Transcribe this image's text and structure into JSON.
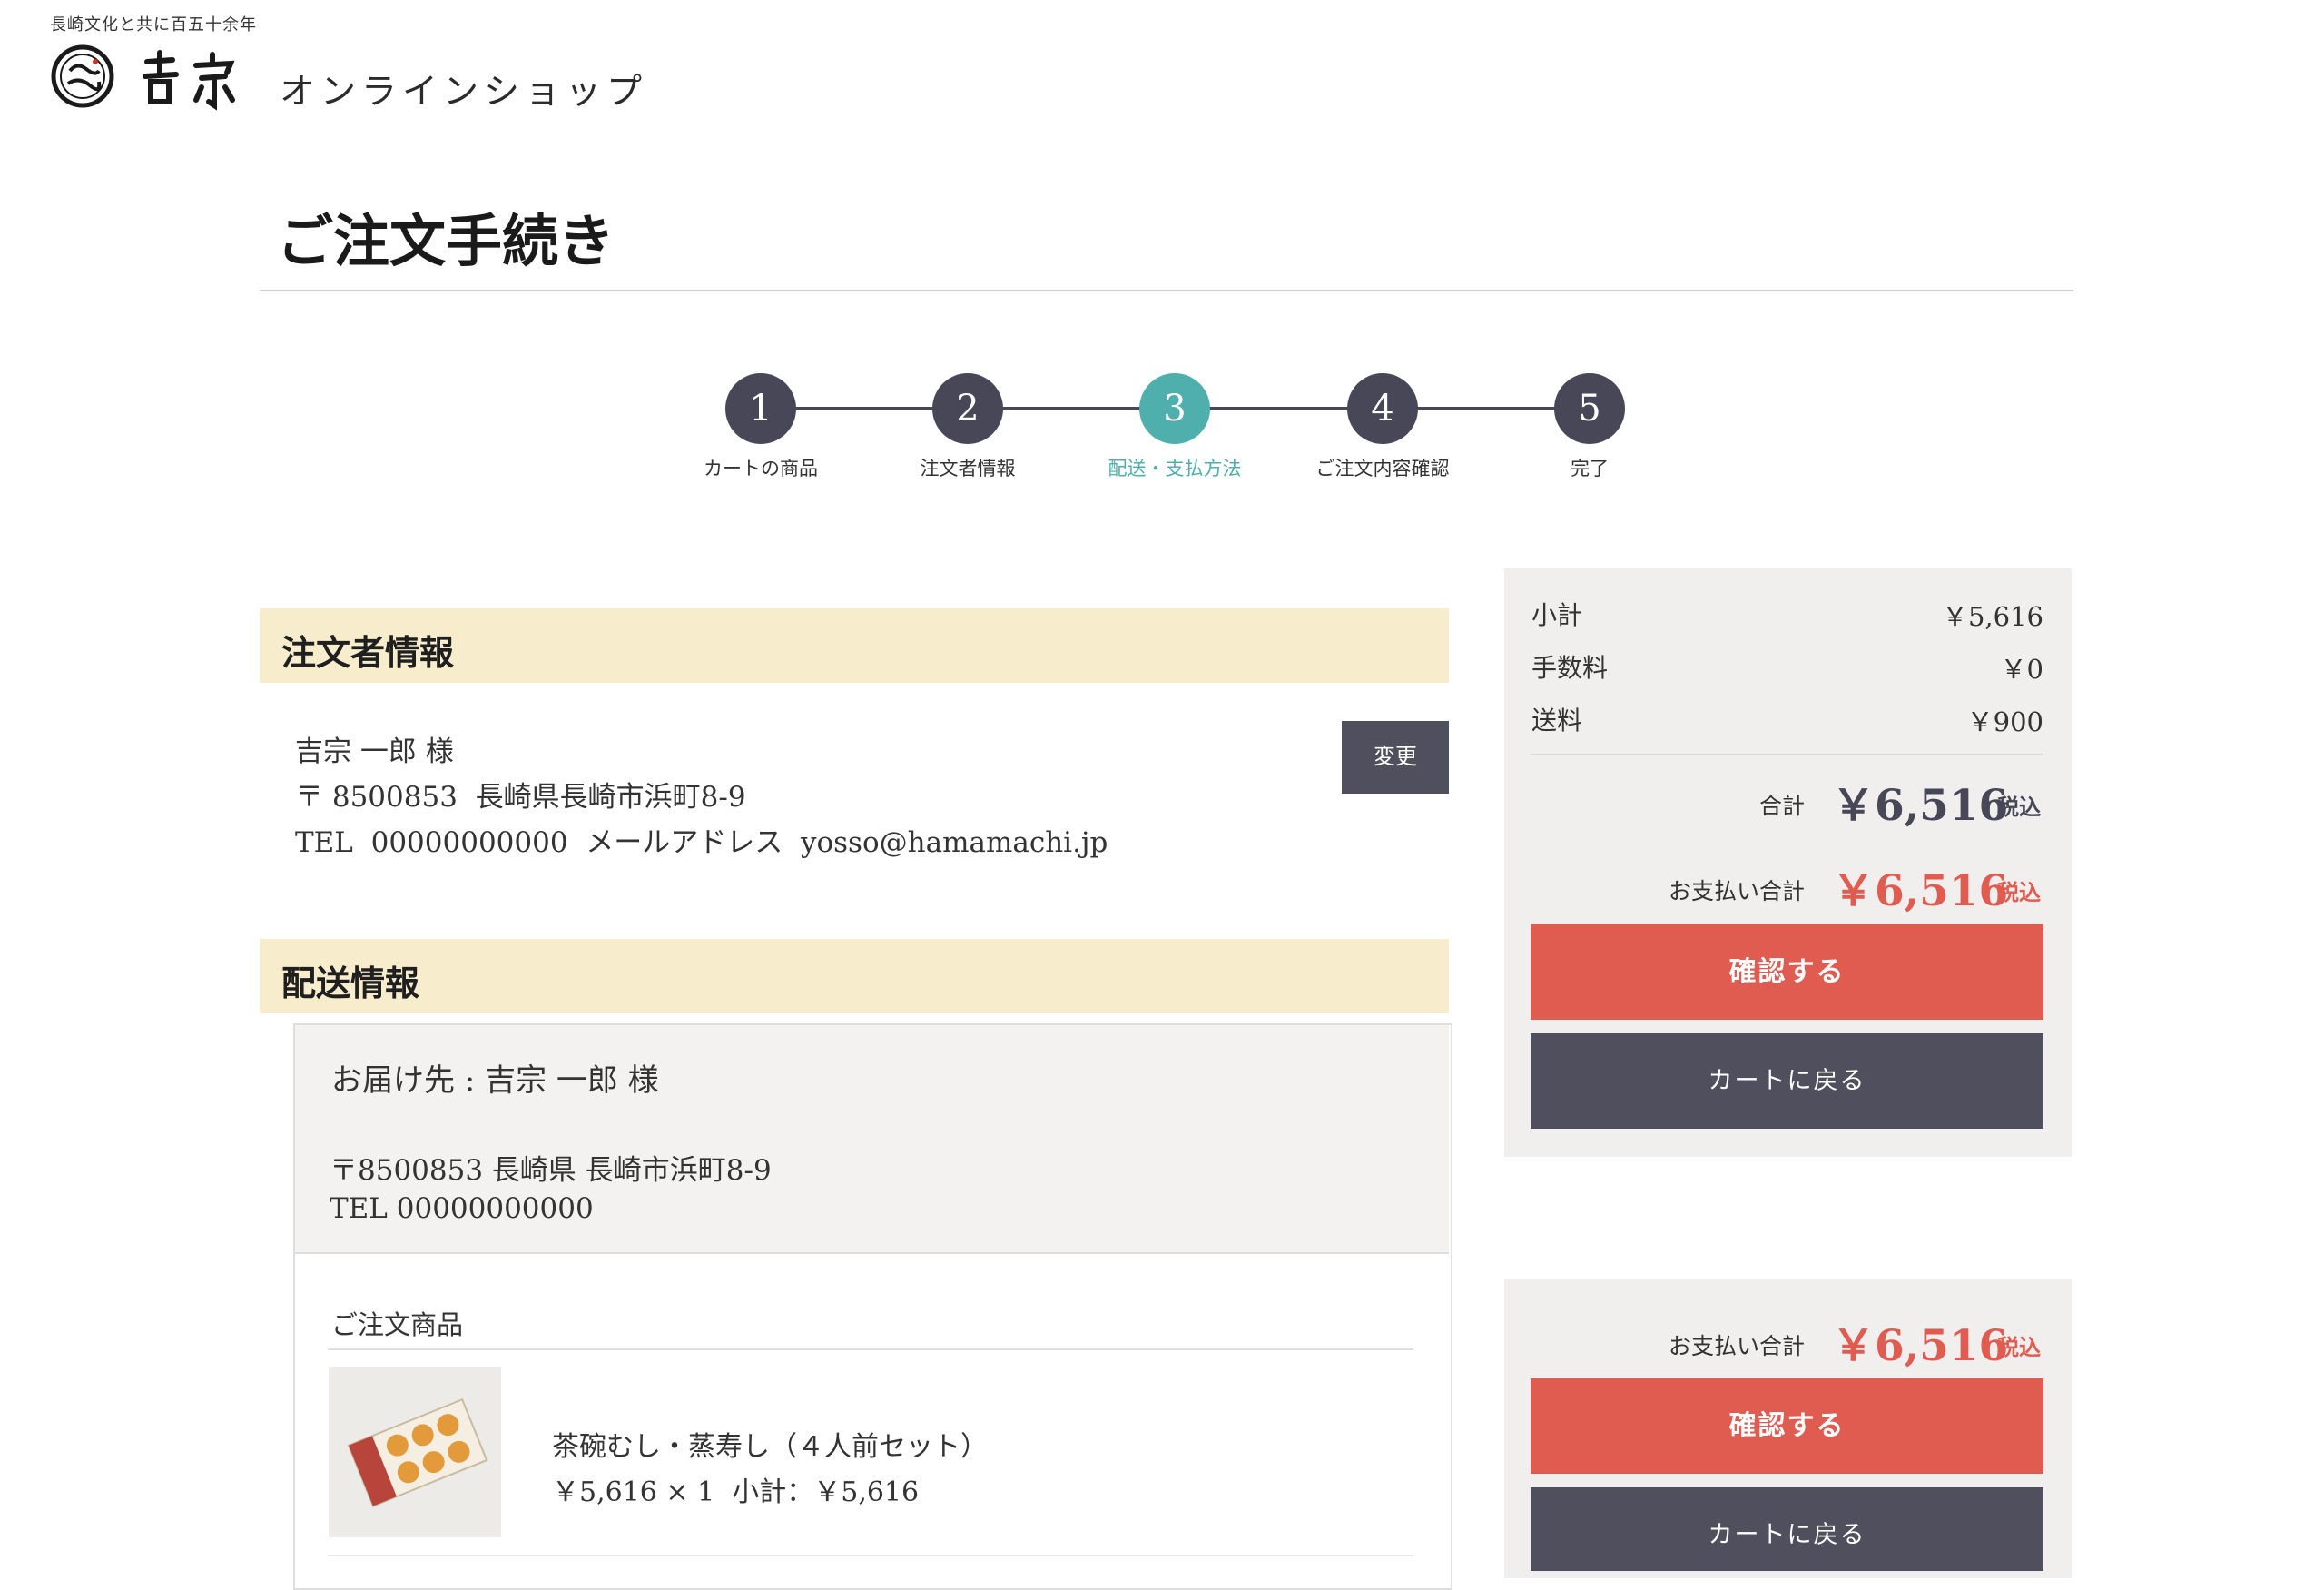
{
  "header": {
    "tagline": "長崎文化と共に百五十余年",
    "logo_text": "吉宗",
    "shop_name": "オンラインショップ"
  },
  "page_title": "ご注文手続き",
  "steps": [
    {
      "num": "1",
      "label": "カートの商品",
      "active": false
    },
    {
      "num": "2",
      "label": "注文者情報",
      "active": false
    },
    {
      "num": "3",
      "label": "配送・支払方法",
      "active": true
    },
    {
      "num": "4",
      "label": "ご注文内容確認",
      "active": false
    },
    {
      "num": "5",
      "label": "完了",
      "active": false
    }
  ],
  "orderer": {
    "heading": "注文者情報",
    "name": "吉宗 一郎 様",
    "address": "〒 8500853  長崎県長崎市浜町8-9",
    "contact": "TEL  00000000000  メールアドレス  yosso@hamamachi.jp",
    "change_label": "変更"
  },
  "shipping": {
    "heading": "配送情報",
    "dest_label": "お届け先 : 吉宗 一郎 様",
    "dest_address": "〒8500853 長崎県 長崎市浜町8-9",
    "dest_tel": "TEL 00000000000",
    "order_items_heading": "ご注文商品",
    "item_name": "茶碗むし・蒸寿し（４人前セット）",
    "item_price_line": "￥5,616 × 1  小計：￥5,616"
  },
  "summary": {
    "subtotal_label": "小計",
    "subtotal_value": "￥5,616",
    "fee_label": "手数料",
    "fee_value": "￥0",
    "shipping_label": "送料",
    "shipping_value": "￥900",
    "total_label": "合計",
    "total_value": "￥6,516",
    "tax_label": "税込",
    "pay_total_label": "お支払い合計",
    "pay_total_value": "￥6,516",
    "confirm_label": "確認する",
    "back_label": "カートに戻る"
  },
  "colors": {
    "accent_teal": "#4eafad",
    "accent_red": "#e05b50",
    "dark_button": "#4f4f5d",
    "section_bg": "#f7edcd"
  }
}
